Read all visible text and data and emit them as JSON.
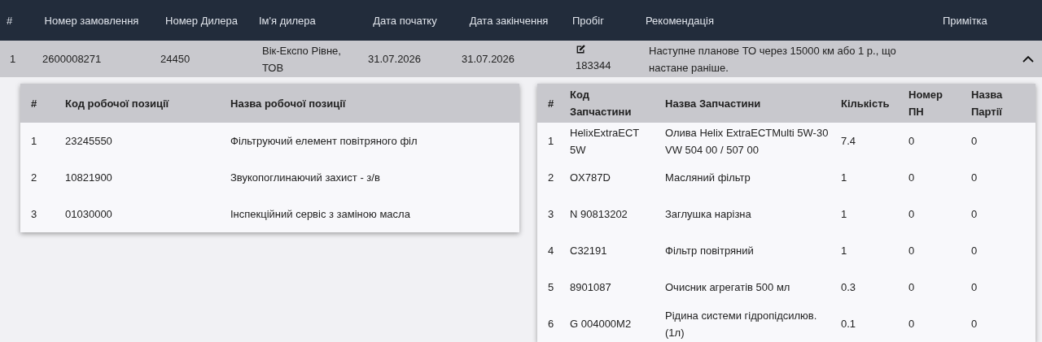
{
  "orders_table": {
    "columns": [
      "#",
      "Номер замовлення",
      "Номер Дилера",
      "Ім'я дилера",
      "Дата початку",
      "Дата закінчення",
      "Пробіг",
      "Рекомендація",
      "Примітка"
    ],
    "rows": [
      {
        "expanded": true,
        "cells": [
          "1",
          "2600008271",
          "24450",
          "Вік-Експо Рівне, ТОВ",
          "31.07.2026",
          "31.07.2026",
          "183344",
          "Наступне планове ТО через 15000 км або 1 р., що настане раніше."
        ]
      }
    ]
  },
  "work_positions": {
    "columns": [
      "#",
      "Код робочої позиції",
      "Назва робочої позиції"
    ],
    "rows": [
      [
        "1",
        "23245550",
        "Фільтруючий елемент повітряного філ"
      ],
      [
        "2",
        "10821900",
        "Звукопоглинаючий захист - з/в"
      ],
      [
        "3",
        "01030000",
        "Інспекційний сервіс з заміною масла"
      ]
    ]
  },
  "parts": {
    "columns": [
      "#",
      "Код Запчастини",
      "Назва Запчастини",
      "Кількість",
      "Номер ПН",
      "Назва Партії"
    ],
    "rows": [
      [
        "1",
        "HelixExtraECT 5W",
        "Олива Helix ExtraECTMulti 5W-30 VW 504 00 / 507 00",
        "7.4",
        "0",
        "0"
      ],
      [
        "2",
        "OX787D",
        "Масляний фільтр",
        "1",
        "0",
        "0"
      ],
      [
        "3",
        "N 90813202",
        "Заглушка нарізна",
        "1",
        "0",
        "0"
      ],
      [
        "4",
        "C32191",
        "Фільтр повітряний",
        "1",
        "0",
        "0"
      ],
      [
        "5",
        "8901087",
        "Очисник агрегатів 500 мл",
        "0.3",
        "0",
        "0"
      ],
      [
        "6",
        "G 004000M2",
        "Рідина системи гідропідсилюв. (1л)",
        "0.1",
        "0",
        "0"
      ]
    ]
  }
}
